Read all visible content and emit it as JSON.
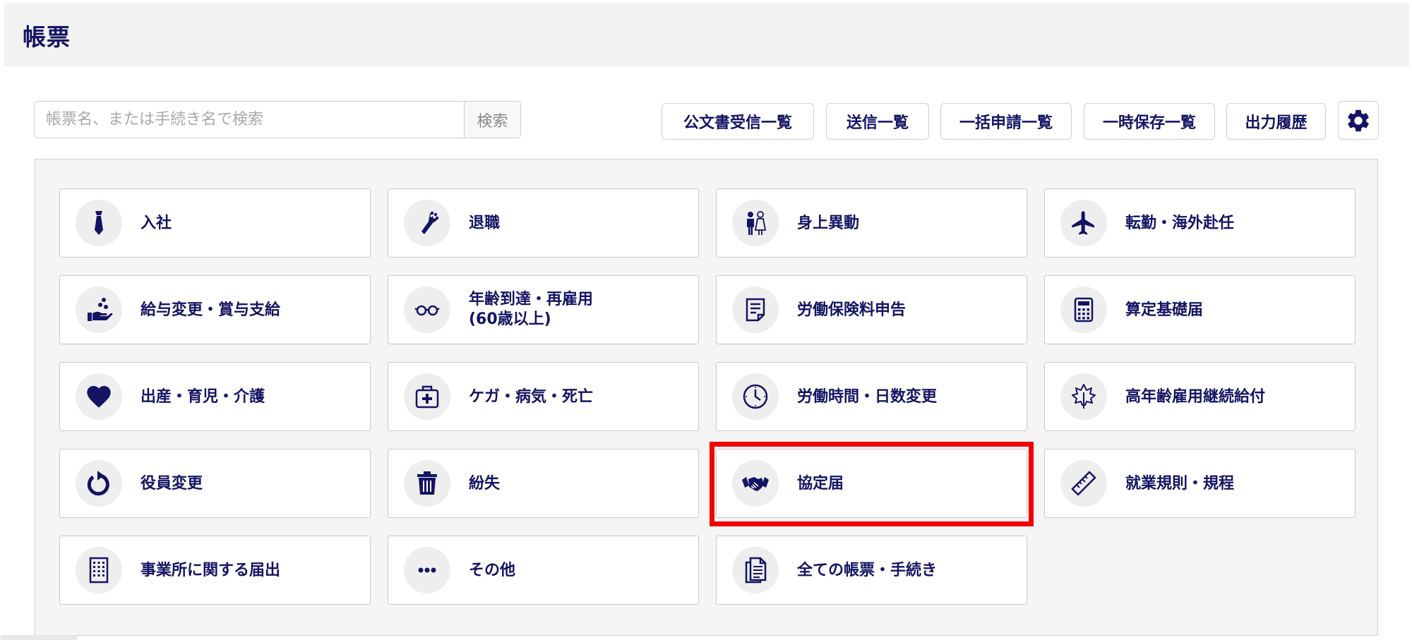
{
  "page": {
    "title": "帳票"
  },
  "search": {
    "placeholder": "帳票名、または手続き名で検索",
    "button_label": "検索"
  },
  "toolbar": {
    "buttons": [
      {
        "label": "公文書受信一覧"
      },
      {
        "label": "送信一覧"
      },
      {
        "label": "一括申請一覧"
      },
      {
        "label": "一時保存一覧"
      },
      {
        "label": "出力履歴"
      }
    ],
    "settings_icon": "gear-icon"
  },
  "categories": [
    {
      "label": "入社",
      "icon": "necktie-icon"
    },
    {
      "label": "退職",
      "icon": "bouquet-icon"
    },
    {
      "label": "身上異動",
      "icon": "couple-icon"
    },
    {
      "label": "転勤・海外赴任",
      "icon": "airplane-icon"
    },
    {
      "label": "給与変更・賞与支給",
      "icon": "hand-coins-icon"
    },
    {
      "label": "年齢到達・再雇用\n(60歳以上)",
      "icon": "glasses-icon"
    },
    {
      "label": "労働保険料申告",
      "icon": "document-icon"
    },
    {
      "label": "算定基礎届",
      "icon": "calculator-icon"
    },
    {
      "label": "出産・育児・介護",
      "icon": "heart-icon"
    },
    {
      "label": "ケガ・病気・死亡",
      "icon": "first-aid-icon"
    },
    {
      "label": "労働時間・日数変更",
      "icon": "clock-icon"
    },
    {
      "label": "高年齢雇用継続給付",
      "icon": "maple-leaf-icon"
    },
    {
      "label": "役員変更",
      "icon": "refresh-icon"
    },
    {
      "label": "紛失",
      "icon": "trash-icon"
    },
    {
      "label": "協定届",
      "icon": "handshake-icon"
    },
    {
      "label": "就業規則・規程",
      "icon": "ruler-icon"
    },
    {
      "label": "事業所に関する届出",
      "icon": "building-icon"
    },
    {
      "label": "その他",
      "icon": "ellipsis-icon"
    },
    {
      "label": "全ての帳票・手続き",
      "icon": "documents-icon"
    }
  ],
  "colors": {
    "navy": "#141464",
    "highlight": "#f20000"
  }
}
